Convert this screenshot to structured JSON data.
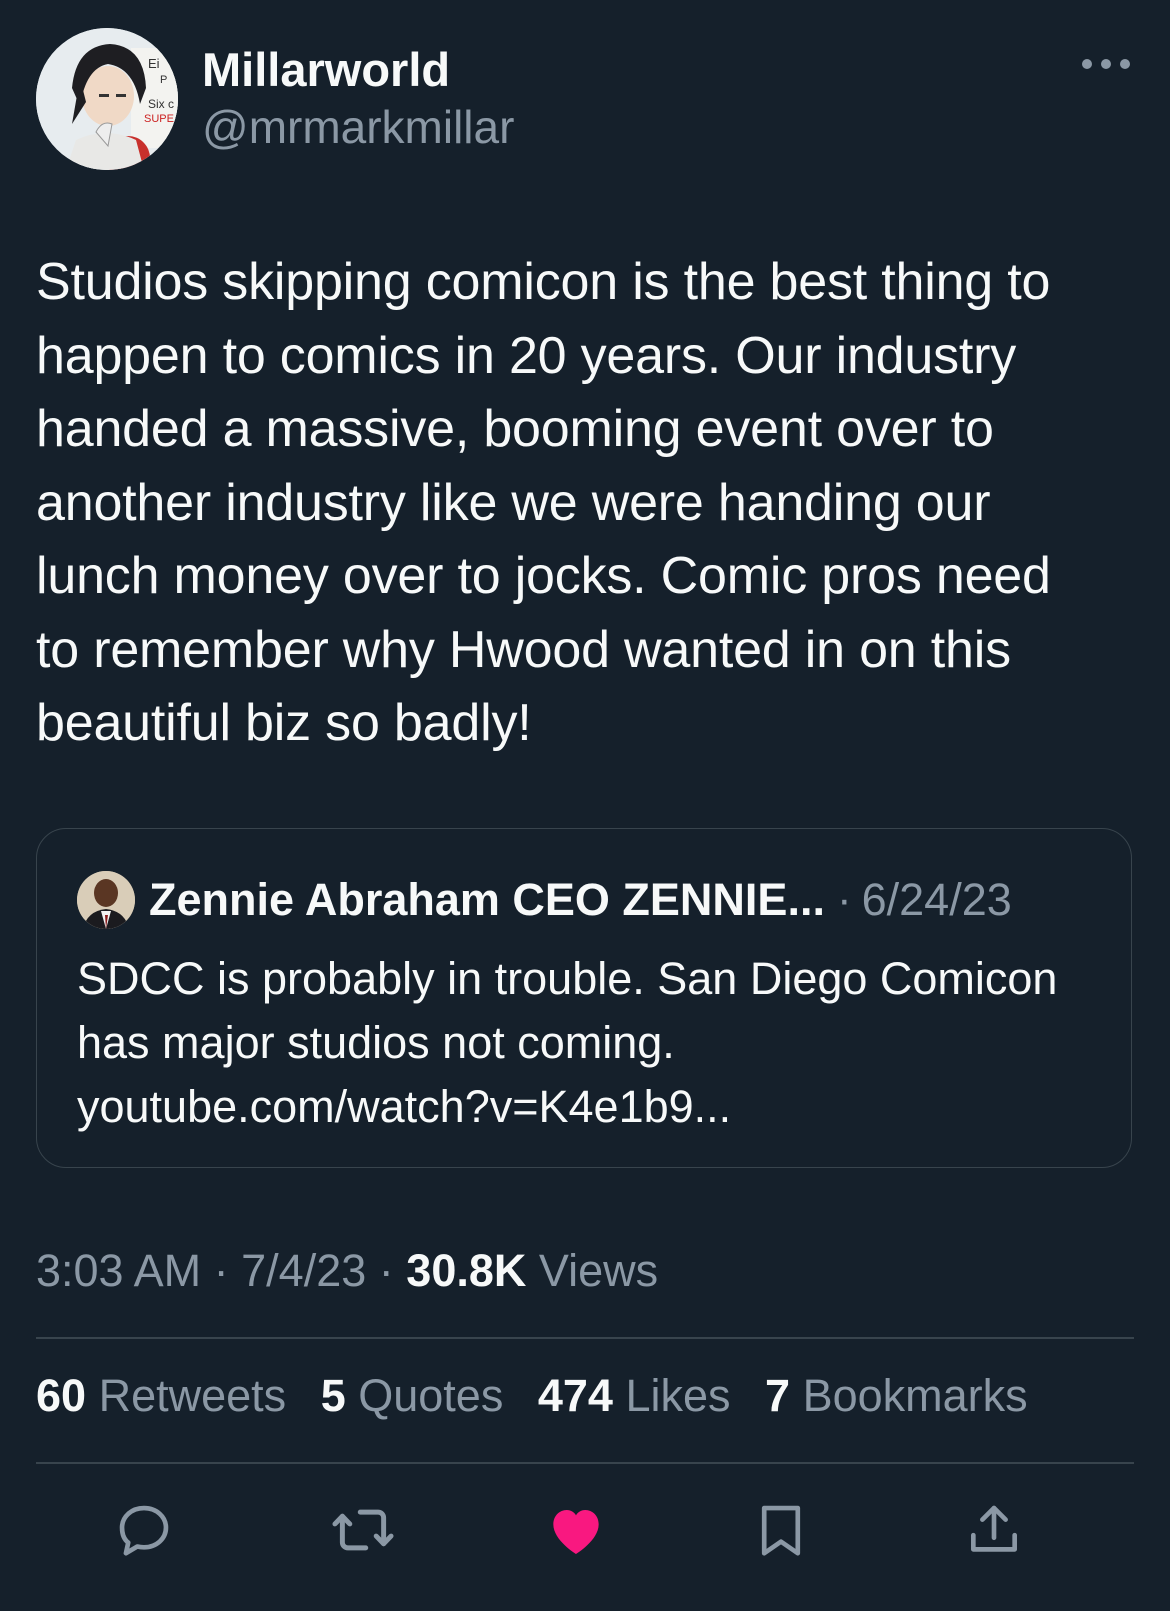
{
  "tweet": {
    "display_name": "Millarworld",
    "handle": "@mrmarkmillar",
    "text": "Studios skipping comicon is the best thing to\nhappen to comics in 20 years. Our industry\nhanded a massive, booming event over to\nanother industry like we were handing our\nlunch money over to jocks. Comic pros need\nto remember why Hwood wanted in on this\nbeautiful biz so badly!",
    "avatar_lettering": [
      "Ei",
      "P",
      "Six c",
      "SUPE"
    ]
  },
  "quote": {
    "display_name": "Zennie Abraham CEO ZENNIE...",
    "separator": "·",
    "date": "6/24/23",
    "text": "SDCC is probably in trouble.  San Diego Comicon has major studios not coming. youtube.com/watch?v=K4e1b9..."
  },
  "meta": {
    "time": "3:03 AM",
    "sep1": "·",
    "date": "7/4/23",
    "sep2": "·",
    "views_count": "30.8K",
    "views_label": "Views"
  },
  "stats": {
    "retweets_count": "60",
    "retweets_label": "Retweets",
    "quotes_count": "5",
    "quotes_label": "Quotes",
    "likes_count": "474",
    "likes_label": "Likes",
    "bookmarks_count": "7",
    "bookmarks_label": "Bookmarks"
  },
  "actions": [
    "reply-icon",
    "retweet-icon",
    "like-icon",
    "bookmark-icon",
    "share-icon"
  ],
  "colors": {
    "background": "#15202b",
    "text": "#f7f9f9",
    "secondary": "#8b98a5",
    "border": "#38444d",
    "like": "#f91880"
  }
}
